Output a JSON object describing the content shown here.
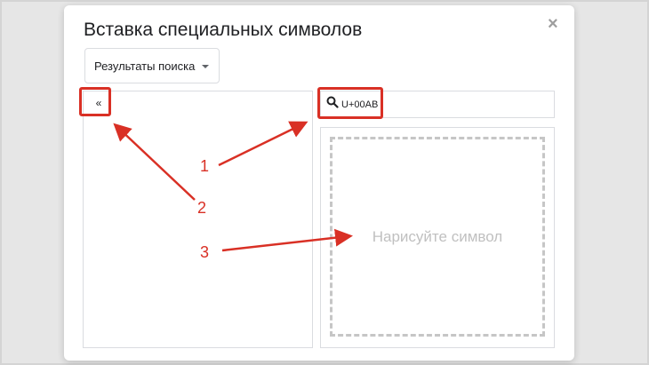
{
  "dialog": {
    "title": "Вставка специальных символов",
    "close_label": "×"
  },
  "filter_dropdown": {
    "selected": "Результаты поиска"
  },
  "results_panel": {
    "collapse_label": "«"
  },
  "search": {
    "icon": "search-icon",
    "value": "U+00AB"
  },
  "draw_panel": {
    "hint": "Нарисуйте символ"
  },
  "annotations": {
    "labels": [
      "1",
      "2",
      "3"
    ],
    "color": "#d93025"
  }
}
